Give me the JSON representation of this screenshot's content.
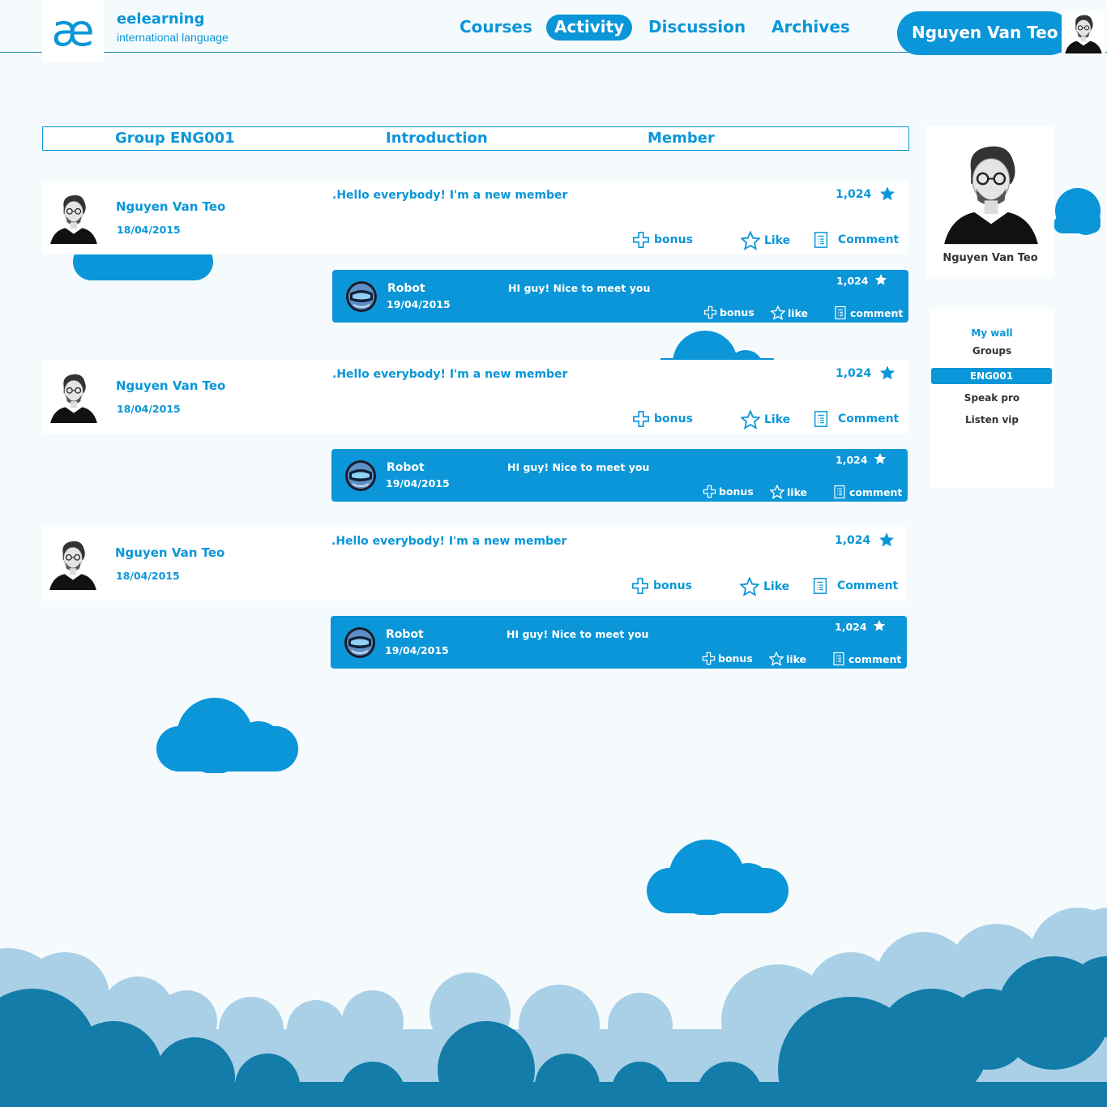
{
  "brand": {
    "logo_text": "æ",
    "name": "eelearning",
    "tagline": "international language"
  },
  "nav": {
    "courses": "Courses",
    "activity": "Activity",
    "discussion": "Discussion",
    "archives": "Archives"
  },
  "user": {
    "name": "Nguyen Van Teo"
  },
  "group_tabs": {
    "group": "Group  ENG001",
    "introduction": "Introduction",
    "member": "Member"
  },
  "posts": [
    {
      "author": "Nguyen Van Teo",
      "date": "18/04/2015",
      "message": ".Hello everybody! I'm a  new member",
      "count": "1,024",
      "bonus": "bonus",
      "like": "Like",
      "comment": "Comment",
      "reply": {
        "author": "Robot",
        "date": "19/04/2015",
        "message": "HI guy! Nice to meet you",
        "count": "1,024",
        "bonus": "bonus",
        "like": "like",
        "comment": "comment"
      }
    },
    {
      "author": "Nguyen Van Teo",
      "date": "18/04/2015",
      "message": ".Hello everybody! I'm a  new member",
      "count": "1,024",
      "bonus": "bonus",
      "like": "Like",
      "comment": "Comment",
      "reply": {
        "author": "Robot",
        "date": "19/04/2015",
        "message": "HI guy! Nice to meet you",
        "count": "1,024",
        "bonus": "bonus",
        "like": "like",
        "comment": "comment"
      }
    },
    {
      "author": "Nguyen Van Teo",
      "date": "18/04/2015",
      "message": ".Hello everybody! I'm a  new member",
      "count": "1,024",
      "bonus": "bonus",
      "like": "Like",
      "comment": "Comment",
      "reply": {
        "author": "Robot",
        "date": "19/04/2015",
        "message": "HI guy! Nice to meet you",
        "count": "1,024",
        "bonus": "bonus",
        "like": "like",
        "comment": "comment"
      }
    }
  ],
  "sidebar": {
    "profile_name": "Nguyen Van Teo",
    "menu": {
      "my_wall": "My wall",
      "groups": "Groups",
      "items": [
        "ENG001",
        "Speak pro",
        "Listen vip"
      ]
    }
  },
  "colors": {
    "accent": "#0a96d8",
    "background": "#f5fbfd",
    "dark_cloud": "#137ca8",
    "light_cloud": "#a9d0e6"
  }
}
